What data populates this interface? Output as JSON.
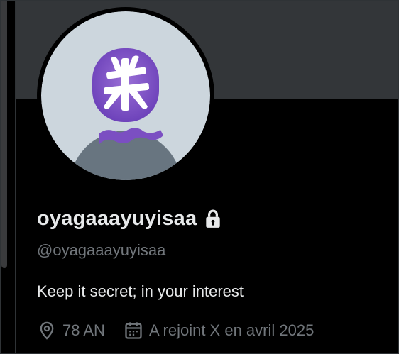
{
  "profile": {
    "display_name": "oyagaaayuyisaa",
    "handle": "@oyagaaayuyisaa",
    "bio": "Keep it secret; in your interest",
    "location": "78 AN",
    "joined": "A rejoint X en avril 2025",
    "protected": true
  },
  "icons": {
    "lock": "lock-icon",
    "location": "location-pin-icon",
    "joined": "calendar-icon"
  },
  "colors": {
    "background": "#000000",
    "banner": "#333639",
    "primary_text": "#e7e9ea",
    "secondary_text": "#71767b",
    "avatar_background": "#ccd6dd",
    "avatar_silhouette": "#687580",
    "avatar_head_accent": "#7b4fc2"
  }
}
